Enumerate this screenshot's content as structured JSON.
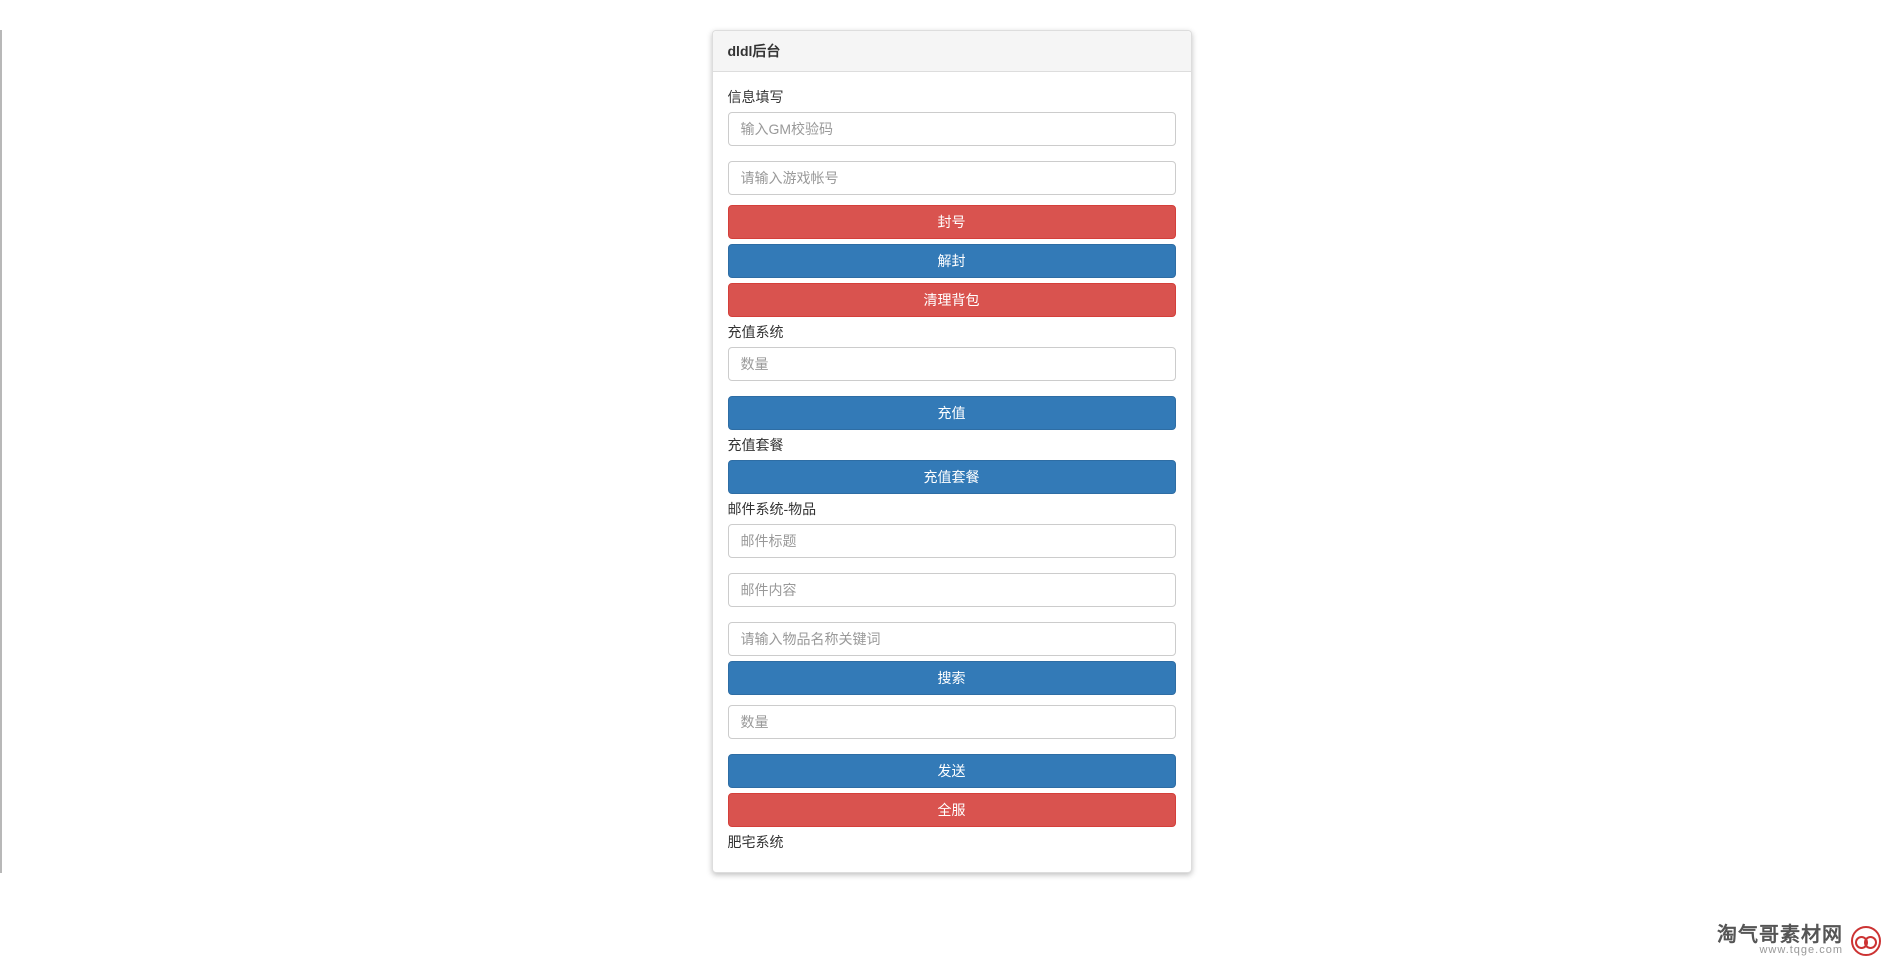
{
  "panel": {
    "title": "dldl后台"
  },
  "sections": {
    "info": {
      "label": "信息填写",
      "gm_code_placeholder": "输入GM校验码",
      "account_placeholder": "请输入游戏帐号",
      "ban_btn": "封号",
      "unban_btn": "解封",
      "clear_bag_btn": "清理背包"
    },
    "recharge": {
      "label": "充值系统",
      "amount_placeholder": "数量",
      "recharge_btn": "充值"
    },
    "package": {
      "label": "充值套餐",
      "package_btn": "充值套餐"
    },
    "mail": {
      "label": "邮件系统-物品",
      "title_placeholder": "邮件标题",
      "content_placeholder": "邮件内容",
      "item_search_placeholder": "请输入物品名称关键词",
      "search_btn": "搜索",
      "quantity_placeholder": "数量",
      "send_btn": "发送",
      "all_server_btn": "全服"
    },
    "feizhai": {
      "label": "肥宅系统"
    }
  },
  "watermark": {
    "cn": "淘气哥素材网",
    "url": "www.tqge.com"
  }
}
